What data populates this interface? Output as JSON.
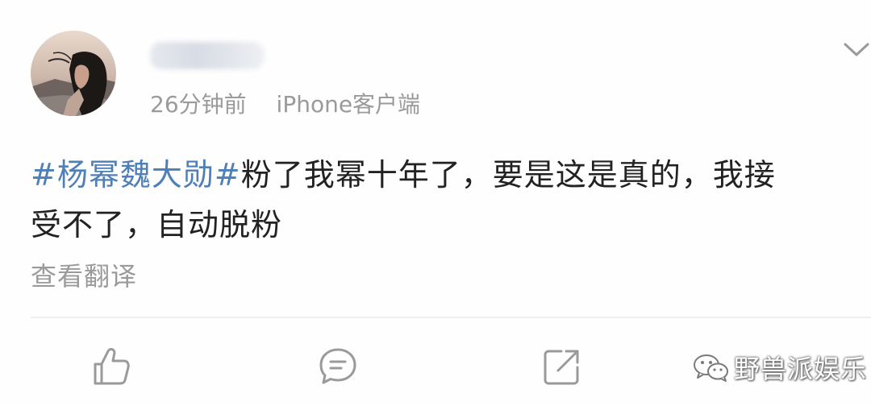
{
  "post": {
    "username": "",
    "time": "26分钟前",
    "source": "iPhone客户端",
    "topic": "#杨幂魏大勋#",
    "text_line1_rest": "粉了我幂十年了，要是这是真的，我接",
    "text_line2": "受不了，自动脱粉",
    "translate_label": "查看翻译"
  },
  "icons": {
    "menu": "chevron-down-icon",
    "like": "thumbs-up-icon",
    "comment": "comment-bubble-icon",
    "repost": "share-arrow-icon"
  },
  "watermark": {
    "text": "野兽派娱乐"
  },
  "colors": {
    "topic_link": "#4e7fb6",
    "body_text": "#222222",
    "meta_text": "#9a9a9a"
  }
}
